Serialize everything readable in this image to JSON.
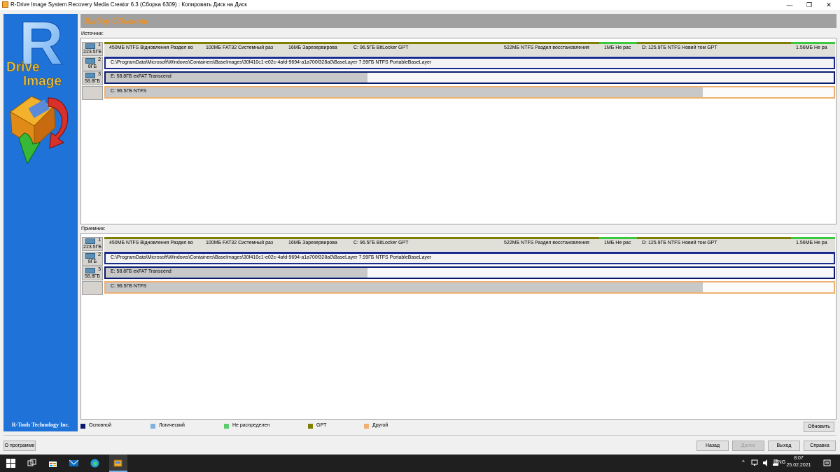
{
  "window": {
    "title": "R-Drive Image System Recovery Media Creator 6.3 (Сборка 6309) : Копировать Диск на Диск",
    "minimize": "—",
    "restore": "❐",
    "close": "✕"
  },
  "banner": {
    "logo_line1": "Drive",
    "logo_line2": "Image",
    "logo_letter": "R",
    "footer": "R-Tools Technology Inc."
  },
  "header": {
    "title": "Выбор Объекта"
  },
  "source": {
    "label": "Источник:",
    "disks": [
      {
        "num": "1",
        "size": "223.5ГБ",
        "partitions": [
          {
            "text": "450МБ  NTFS  Відновлення Раздел во"
          },
          {
            "text": "100МБ  FAT32   Системный раз"
          },
          {
            "text": "16МБ     Зарезервирова"
          },
          {
            "text": "C:  96.5ГБ  BitLocker   GPT"
          },
          {
            "text": "522МБ  NTFS   Раздел восстановления"
          },
          {
            "text": "1МБ  Не рас"
          },
          {
            "text": "D:  125.9ГБ  NTFS   Новий том GPT"
          },
          {
            "text": "1.56МБ  Не ра"
          }
        ]
      },
      {
        "num": "2",
        "size": "8ГБ",
        "partitions": [
          {
            "text": "C:\\ProgramData\\Microsoft\\Windows\\Containers\\BaseImages\\30f410c1-e02c-4afd-9694-a1a700f328a0\\BaseLayer  7.99ГБ  NTFS  PortableBaseLayer"
          }
        ]
      },
      {
        "num": "3",
        "size": "58.8ГБ",
        "partitions": [
          {
            "text": "E:  58.8ГБ  exFAT  Transcend",
            "used": 0.36
          }
        ]
      },
      {
        "num": "",
        "size": "",
        "partitions": [
          {
            "text": "C:  96.5ГБ  NTFS",
            "used": 0.82
          }
        ]
      }
    ]
  },
  "target": {
    "label": "Приемник:",
    "disks": [
      {
        "num": "1",
        "size": "223.5ГБ",
        "partitions": [
          {
            "text": "450МБ  NTFS  Відновлення Раздел во"
          },
          {
            "text": "100МБ  FAT32   Системный раз"
          },
          {
            "text": "16МБ     Зарезервирова"
          },
          {
            "text": "C:  96.5ГБ  BitLocker   GPT"
          },
          {
            "text": "522МБ  NTFS   Раздел восстановления"
          },
          {
            "text": "1МБ  Не рас"
          },
          {
            "text": "D:  125.9ГБ  NTFS   Новий том GPT"
          },
          {
            "text": "1.56МБ  Не ра"
          }
        ]
      },
      {
        "num": "2",
        "size": "8ГБ",
        "partitions": [
          {
            "text": "C:\\ProgramData\\Microsoft\\Windows\\Containers\\BaseImages\\30f410c1-e02c-4afd-9694-a1a700f328a0\\BaseLayer  7.99ГБ  NTFS  PortableBaseLayer"
          }
        ]
      },
      {
        "num": "3",
        "size": "58.8ГБ",
        "partitions": [
          {
            "text": "E:  58.8ГБ  exFAT  Transcend",
            "used": 0.36
          }
        ]
      },
      {
        "num": "",
        "size": "",
        "partitions": [
          {
            "text": "C:  96.5ГБ  NTFS",
            "used": 0.82
          }
        ]
      }
    ]
  },
  "legend": [
    {
      "label": "Основной",
      "color": "#0a1a6e"
    },
    {
      "label": "Логический",
      "color": "#7fb0e0"
    },
    {
      "label": "Не распределен",
      "color": "#5ccc6c"
    },
    {
      "label": "GPT",
      "color": "#7f7f00"
    },
    {
      "label": "Другой",
      "color": "#f0b070"
    }
  ],
  "buttons": {
    "refresh": "Обновить",
    "about": "О программе",
    "back": "Назад",
    "next": "Далее",
    "exit": "Выход",
    "help": "Справка"
  },
  "taskbar": {
    "icons": [
      "windows-start-icon",
      "task-view-icon",
      "store-icon",
      "mail-icon",
      "edge-icon",
      "rdrive-icon"
    ],
    "tray": {
      "chevron": "^",
      "lang": "ENG",
      "time": "8:07",
      "date": "25.02.2021"
    }
  },
  "colors": {
    "banner_blue": "#1e72d8",
    "header_title": "#e8902a",
    "gpt_olive": "#7f7f00",
    "unallocated_green": "#3cc83c",
    "primary_navy": "#0a1a6e",
    "other_orange": "#f0b070"
  }
}
